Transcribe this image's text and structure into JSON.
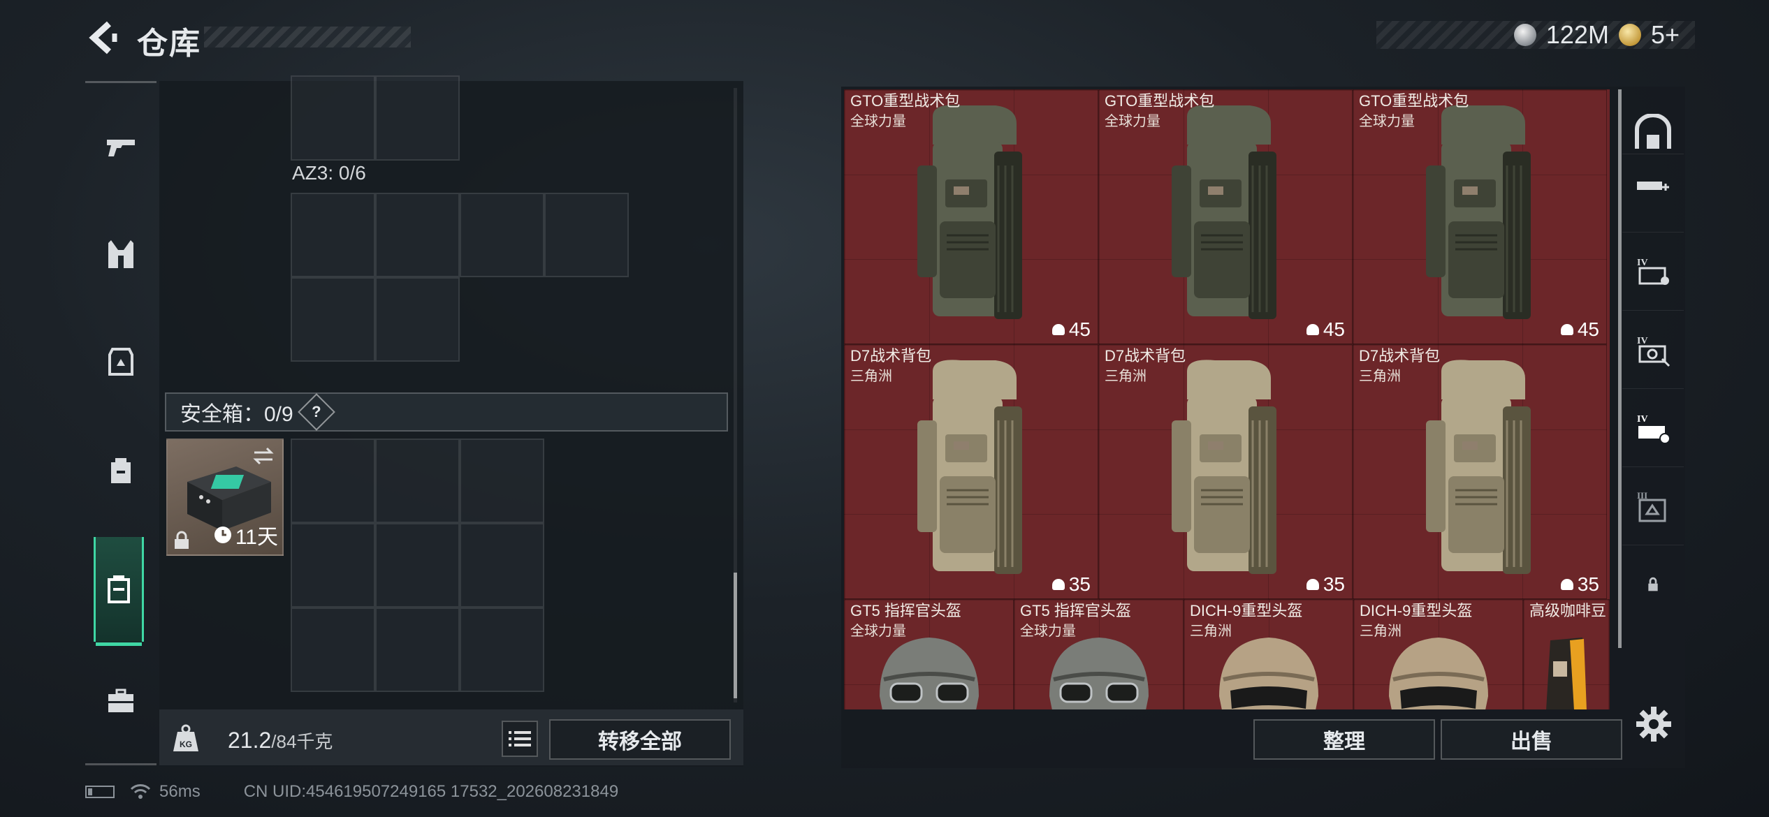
{
  "header": {
    "title": "仓库",
    "currency_silver": "122M",
    "currency_gold": "5+"
  },
  "left_sidebar": {
    "items": [
      {
        "icon": "pistol-icon"
      },
      {
        "icon": "vest-icon"
      },
      {
        "icon": "armor-icon"
      },
      {
        "icon": "backpack-icon"
      },
      {
        "icon": "safe-box-icon",
        "active": true
      },
      {
        "icon": "briefcase-icon"
      }
    ]
  },
  "inventory": {
    "az3_label": "AZ3: 0/6",
    "safe_box_label": "安全箱：0/9",
    "safe_box_help": "?",
    "safe_item_days": "11天",
    "weight_current": "21.2",
    "weight_max": "/84千克",
    "transfer_all_label": "转移全部"
  },
  "status": {
    "ping": "56ms",
    "uid": "CN UID:454619507249165 17532_202608231849"
  },
  "storage": {
    "items": [
      {
        "name": "GTO重型战术包",
        "source": "全球力量",
        "capacity": "45",
        "kind": "backpack",
        "tone": "dark"
      },
      {
        "name": "GTO重型战术包",
        "source": "全球力量",
        "capacity": "45",
        "kind": "backpack",
        "tone": "dark"
      },
      {
        "name": "GTO重型战术包",
        "source": "全球力量",
        "capacity": "45",
        "kind": "backpack",
        "tone": "dark"
      },
      {
        "name": "D7战术背包",
        "source": "三角洲",
        "capacity": "35",
        "kind": "backpack",
        "tone": "tan"
      },
      {
        "name": "D7战术背包",
        "source": "三角洲",
        "capacity": "35",
        "kind": "backpack",
        "tone": "tan"
      },
      {
        "name": "D7战术背包",
        "source": "三角洲",
        "capacity": "35",
        "kind": "backpack",
        "tone": "tan"
      },
      {
        "name": "GT5 指挥官头盔",
        "source": "全球力量",
        "kind": "helmet",
        "tone": "dark"
      },
      {
        "name": "GT5 指挥官头盔",
        "source": "全球力量",
        "kind": "helmet",
        "tone": "dark"
      },
      {
        "name": "DICH-9重型头盔",
        "source": "三角洲",
        "kind": "helmet",
        "tone": "tan"
      },
      {
        "name": "DICH-9重型头盔",
        "source": "三角洲",
        "kind": "helmet",
        "tone": "tan"
      },
      {
        "name": "高级咖啡豆",
        "source": "",
        "kind": "coffee",
        "tone": "tan"
      }
    ],
    "sort_label": "整理",
    "sell_label": "出售"
  },
  "right_sidebar": {
    "items": [
      "storage-home-icon",
      "weapon-add-icon",
      "level-iv-box-icon",
      "level-iv-camera-icon",
      "level-iv-tray-icon",
      "level-iii-box-icon",
      "lock-icon"
    ]
  },
  "colors": {
    "accent": "#3fd7a4",
    "tile_red": "#6c2629",
    "panel": "#161b20"
  }
}
